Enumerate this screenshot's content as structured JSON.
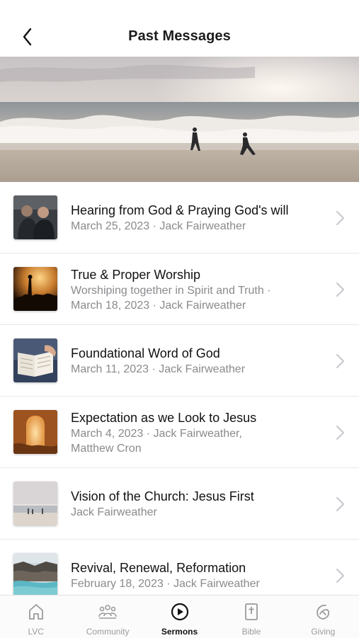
{
  "status_bar": {
    "text": ""
  },
  "header": {
    "title": "Past Messages"
  },
  "sermons": [
    {
      "title": "Hearing from God & Praying God's will",
      "lines": [
        "March 25, 2023 · Jack Fairweather"
      ],
      "thumb": "men-praying"
    },
    {
      "title": "True & Proper Worship",
      "lines": [
        "Worshiping together in Spirit and Truth ·",
        "March 18, 2023 · Jack Fairweather"
      ],
      "thumb": "worship-crowd"
    },
    {
      "title": "Foundational Word of God",
      "lines": [
        "March 11, 2023 · Jack Fairweather"
      ],
      "thumb": "open-bible"
    },
    {
      "title": "Expectation as we Look to Jesus",
      "lines": [
        "March 4, 2023 · Jack Fairweather,",
        "Matthew Cron"
      ],
      "thumb": "empty-tomb"
    },
    {
      "title": "Vision of the Church: Jesus First",
      "lines": [
        "Jack Fairweather"
      ],
      "thumb": "beach-people"
    },
    {
      "title": "Revival, Renewal, Reformation",
      "lines": [
        "February 18, 2023 · Jack Fairweather"
      ],
      "thumb": "coast-lagoon"
    }
  ],
  "tabs": [
    {
      "label": "LVC",
      "icon": "home-icon",
      "active": false
    },
    {
      "label": "Community",
      "icon": "people-icon",
      "active": false
    },
    {
      "label": "Sermons",
      "icon": "play-circle-icon",
      "active": true
    },
    {
      "label": "Bible",
      "icon": "bible-icon",
      "active": false
    },
    {
      "label": "Giving",
      "icon": "giving-icon",
      "active": false
    }
  ],
  "colors": {
    "text": "#1c1c1e",
    "secondary": "#8a8a8e",
    "inactive_tab": "#9b9b9b",
    "divider": "#e8e8e8"
  }
}
